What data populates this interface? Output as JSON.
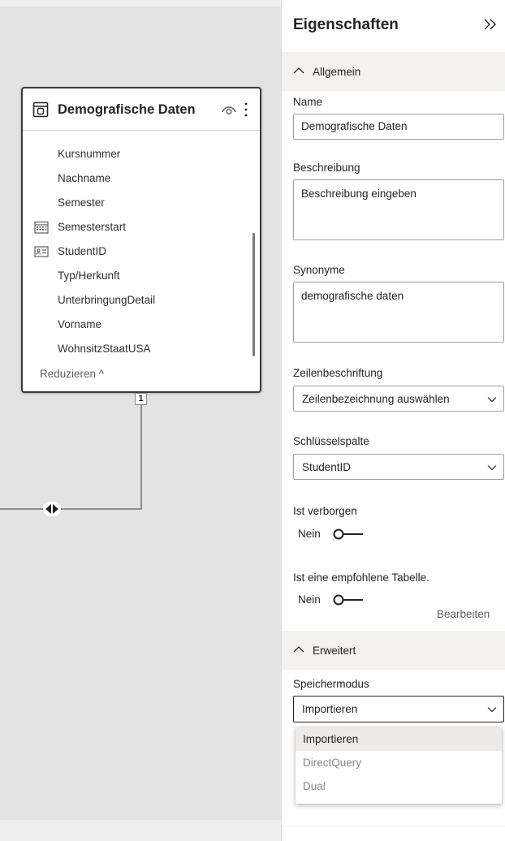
{
  "canvas": {
    "table": {
      "title": "Demografische Daten",
      "fields": [
        {
          "label": "Kursnummer",
          "icon": ""
        },
        {
          "label": "Nachname",
          "icon": ""
        },
        {
          "label": "Semester",
          "icon": ""
        },
        {
          "label": "Semesterstart",
          "icon": "calendar-icon"
        },
        {
          "label": "StudentID",
          "icon": "id-card-icon"
        },
        {
          "label": "Typ/Herkunft",
          "icon": ""
        },
        {
          "label": "UnterbringungDetail",
          "icon": ""
        },
        {
          "label": "Vorname",
          "icon": ""
        },
        {
          "label": "WohnsitzStaatUSA",
          "icon": ""
        }
      ],
      "reduce_label": "Reduzieren ^"
    },
    "relationship": {
      "cardinality": "1",
      "direction_icon": "bidirectional-arrows-icon"
    }
  },
  "properties": {
    "title": "Eigenschaften",
    "general_section": "Allgemein",
    "name_label": "Name",
    "name_value": "Demografische Daten",
    "description_label": "Beschreibung",
    "description_placeholder": "Beschreibung eingeben",
    "synonyms_label": "Synonyme",
    "synonyms_value": "demografische daten",
    "row_label_label": "Zeilenbeschriftung",
    "row_label_value": "Zeilenbezeichnung auswählen",
    "key_column_label": "Schlüsselspalte",
    "key_column_value": "StudentID",
    "hidden_label": "Ist verborgen",
    "hidden_value": "Nein",
    "featured_label": "Ist eine empfohlene Tabelle.",
    "featured_value": "Nein",
    "edit_label": "Bearbeiten",
    "advanced_section": "Erweitert",
    "storage_mode_label": "Speichermodus",
    "storage_mode_value": "Importieren",
    "storage_mode_options": [
      "Importieren",
      "DirectQuery",
      "Dual"
    ]
  },
  "colors": {
    "canvas_background": "#e3e3e3",
    "card_border": "#3b3a39",
    "section_background": "#f3f2f1",
    "text": "#252423",
    "muted_text": "#605e5c"
  }
}
